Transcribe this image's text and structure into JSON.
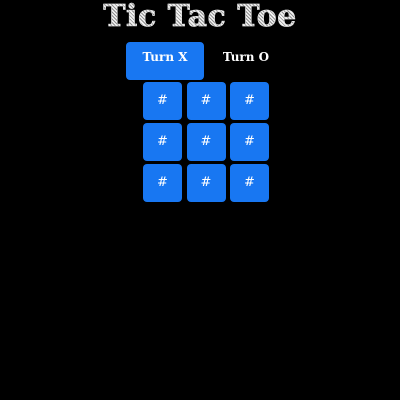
{
  "title": "Tic Tac Toe",
  "turns": {
    "x_label": "Turn X",
    "o_label": "Turn O",
    "active": "X"
  },
  "board": {
    "cells": [
      "#",
      "#",
      "#",
      "#",
      "#",
      "#",
      "#",
      "#",
      "#"
    ]
  },
  "colors": {
    "background": "#000000",
    "accent": "#1877f2",
    "text": "#ffffff"
  }
}
